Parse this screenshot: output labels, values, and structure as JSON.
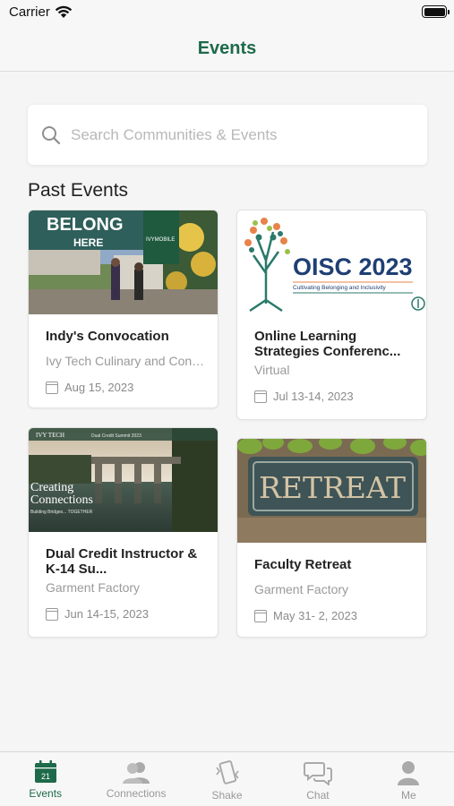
{
  "status_bar": {
    "carrier": "Carrier"
  },
  "nav": {
    "title": "Events"
  },
  "search": {
    "placeholder": "Search Communities & Events"
  },
  "section": {
    "title": "Past Events"
  },
  "events": [
    {
      "title": "Indy's Convocation",
      "subtitle": "Ivy Tech Culinary and Confe...",
      "date": "Aug 15, 2023",
      "image_text": [
        "BELONG",
        "HERE",
        "IVYMOBILE"
      ]
    },
    {
      "title": "Online Learning Strategies Conferenc...",
      "subtitle": "Virtual",
      "date": "Jul 13-14, 2023",
      "image_text": [
        "OISC 2023",
        "Cultivating Belonging and Inclusivity"
      ]
    },
    {
      "title": "Dual Credit Instructor & K-14 Su...",
      "subtitle": "Garment Factory",
      "date": "Jun 14-15, 2023",
      "image_text": [
        "IVY TECH",
        "Dual Credit Summit 2023",
        "Creating",
        "Connections",
        "Building Bridges... TOGETHER"
      ]
    },
    {
      "title": "Faculty Retreat",
      "subtitle": "Garment Factory",
      "date": "May 31- 2, 2023",
      "image_text": [
        "RETREAT"
      ]
    }
  ],
  "tabs": [
    {
      "label": "Events",
      "icon": "calendar-icon",
      "badge": "21",
      "active": true
    },
    {
      "label": "Connections",
      "icon": "people-icon",
      "active": false
    },
    {
      "label": "Shake",
      "icon": "shake-phone-icon",
      "active": false
    },
    {
      "label": "Chat",
      "icon": "chat-bubbles-icon",
      "active": false
    },
    {
      "label": "Me",
      "icon": "person-icon",
      "active": false
    }
  ],
  "colors": {
    "brand": "#1e6a4a",
    "inactive": "#999999",
    "placeholder": "#b8b8b8"
  }
}
